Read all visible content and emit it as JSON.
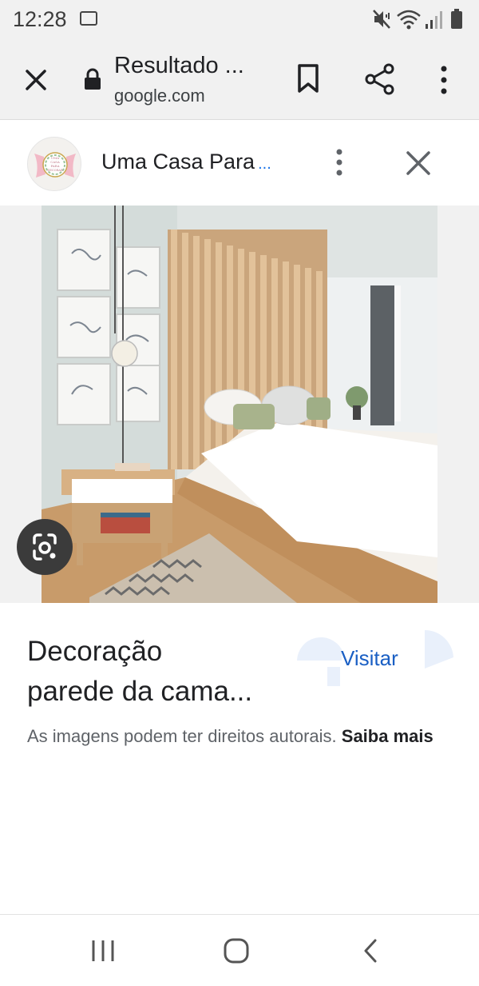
{
  "status_bar": {
    "time": "12:28",
    "icons": [
      "gallery-icon",
      "mute-icon",
      "wifi-icon",
      "signal-icon",
      "battery-icon"
    ]
  },
  "toolbar": {
    "title": "Resultado ...",
    "url": "google.com",
    "icons": [
      "close-icon",
      "lock-icon",
      "bookmark-icon",
      "share-icon",
      "more-vert-icon"
    ]
  },
  "source": {
    "name": "Uma Casa Para",
    "ellipsis": "...",
    "logo_text": [
      "UMA",
      "CASA",
      "PARA",
      "DECORAR"
    ]
  },
  "result": {
    "title_line1": "Decoração",
    "title_line2": "parede da cama...",
    "visit_label": "Visitar",
    "copyright_text": "As imagens podem ter direitos autorais.",
    "learn_more_label": "Saiba mais"
  },
  "nav_bar": {
    "icons": [
      "recents-icon",
      "home-icon",
      "back-icon"
    ]
  },
  "colors": {
    "link_blue": "#1a5fc4",
    "toolbar_bg": "#f1f1f1",
    "lens_button_bg": "#3b3b3b"
  }
}
